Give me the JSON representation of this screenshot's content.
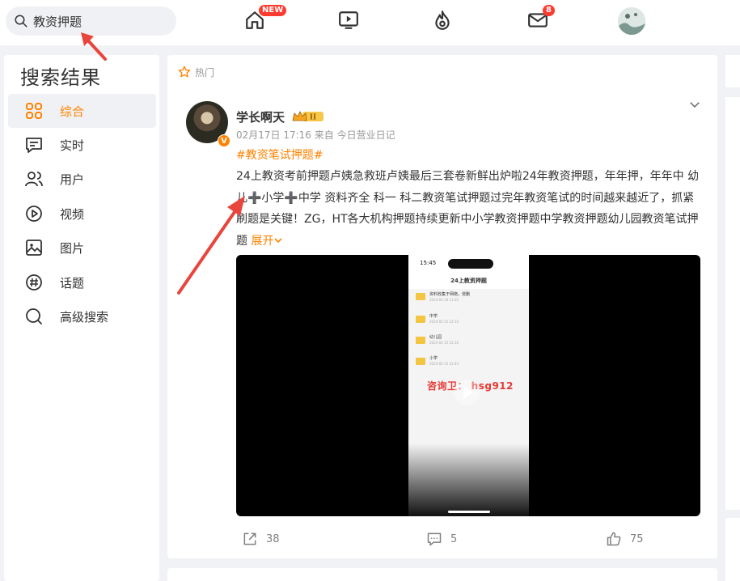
{
  "search": {
    "query": "教资押题"
  },
  "nav": {
    "home_badge": "NEW",
    "message_badge": "8"
  },
  "sidebar": {
    "title": "搜索结果",
    "items": [
      {
        "label": "综合",
        "icon": "grid-icon",
        "active": true
      },
      {
        "label": "实时",
        "icon": "realtime-icon"
      },
      {
        "label": "用户",
        "icon": "users-icon"
      },
      {
        "label": "视频",
        "icon": "video-play-icon"
      },
      {
        "label": "图片",
        "icon": "image-icon"
      },
      {
        "label": "话题",
        "icon": "hashtag-icon"
      },
      {
        "label": "高级搜索",
        "icon": "search-icon"
      }
    ]
  },
  "post": {
    "hot_label": "热门",
    "author": "学长啊天",
    "verified": "V",
    "meta": "02月17日 17:16  来自 今日营业日记",
    "topic": "#教资笔试押题#",
    "text": "24上教资考前押题卢姨急救班卢姨最后三套卷新鲜出炉啦24年教资押题，年年押，年年中 幼儿➕小学➕中学 资料齐全 科一 科二教资笔试押题过完年教资笔试的时间越来越近了，抓紧刷题是关键！ZG，HT各大机构押题持续更新中小学教资押题中学教资押题幼儿园教资笔试押题 ",
    "expand": "展开",
    "video": {
      "time": "15:45",
      "screen_title": "24上教资押题",
      "folders": [
        {
          "name": "资料收集于网络，侵删",
          "date": "2024-02-16 11:03"
        },
        {
          "name": "中学",
          "date": "2024-02-15 22:15"
        },
        {
          "name": "幼儿园",
          "date": "2024-02-15 22:16"
        },
        {
          "name": "小学",
          "date": "2024-02-15 22:44"
        }
      ],
      "watermark": "咨询卫：    hsg912"
    },
    "actions": {
      "share": "38",
      "comment": "5",
      "like": "75"
    }
  },
  "colors": {
    "accent": "#ff8200",
    "badge": "#ff3b30",
    "annotation": "#e8453c"
  }
}
